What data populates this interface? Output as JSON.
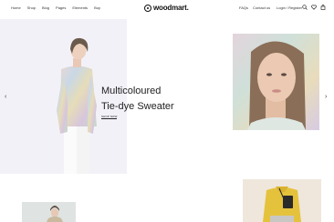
{
  "header": {
    "nav": [
      "Home",
      "Shop",
      "Blog",
      "Pages",
      "Elements",
      "Buy"
    ],
    "logo_text": "woodmart.",
    "right_links": [
      "FAQs",
      "Contact us"
    ],
    "login": "Login / Register",
    "icons": [
      "search-icon",
      "heart-icon",
      "cart-icon"
    ]
  },
  "hero": {
    "headline_line1": "Multicoloured",
    "headline_line2": "Tie-dye Sweater",
    "shop_link": "SHOP NOW",
    "prev_arrow": "‹",
    "next_arrow": "›"
  },
  "colors": {
    "hero_bg": "#f3f1f8",
    "text": "#222222"
  }
}
